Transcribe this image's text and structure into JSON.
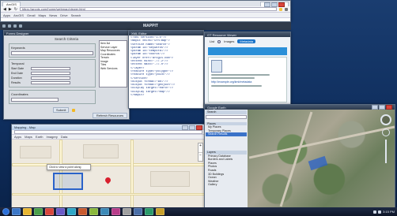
{
  "top_browser": {
    "tab": "ArcGIS",
    "url": "https://arcgis.com/home/webmap/viewer.html",
    "bookmarks": [
      "Apps",
      "ArcGIS",
      "Gmail",
      "Maps",
      "News",
      "Drive",
      "Search"
    ]
  },
  "dev_window": {
    "title": "Forms Designer",
    "app_title": "MAPPIT",
    "form_title": "Search Criteria",
    "group1": "Keywords",
    "group2": "Temporal",
    "group3": "Coordinates",
    "field_labels": [
      "Start Date",
      "End Date",
      "Duration",
      "Results"
    ],
    "submit_label": "Submit",
    "refresh_label": "Refresh Resources",
    "list_items": [
      "Item list",
      "Service Layer",
      "Map Resources",
      "Coordinates",
      "Terrain",
      "Image",
      "Tiles",
      "Web Services"
    ]
  },
  "xml_panel": {
    "title": "XML Editor",
    "lines": [
      "<?xml version=\"1.0\"?>",
      "<mapit xmlns=\"urn:map\">",
      " <service name=\"search\">",
      "  <param id=\"keywords\"/>",
      "  <param id=\"temporal\"/>",
      "  <param id=\"coords\"/>",
      "  <layer href=\"arcgis.com\">",
      "   <extent minx=\"-77.2\"/>",
      "   <extent maxx=\"-77.0\"/>",
      "  </layer>",
      "  <feature type=\"polygon\"/>",
      "  <feature type=\"point\"/>",
      " </service>",
      " <output format=\"kml\"/>",
      " <output format=\"geojson\"/>",
      " <display target=\"earth\"/>",
      " <display target=\"map\"/>",
      "</mapit>"
    ]
  },
  "right_dialog": {
    "title": "GT Resource Viewer",
    "toggle_left": "List",
    "toggle_mid": "Images",
    "toggle_right": "Metadata",
    "url_text": "http://example.org/kml/metadata"
  },
  "map_browser": {
    "title": "Mapping - Map",
    "tooltip": "Click to view a point along",
    "bookmarks": [
      "Apps",
      "Maps",
      "Earth",
      "Imagery",
      "Data"
    ]
  },
  "earth": {
    "title": "Google Earth",
    "search_header": "Search",
    "places_header": "Places",
    "layers_header": "Layers",
    "places": [
      "My Places",
      "Temporary Places",
      "Search Results"
    ],
    "layers": [
      "Primary Database",
      "Borders and Labels",
      "Places",
      "Photos",
      "Roads",
      "3D Buildings",
      "Ocean",
      "Weather",
      "Gallery"
    ]
  },
  "taskbar": {
    "clock": "3:15 PM"
  },
  "colors": {
    "accent": "#1a73c8",
    "pin": "#d8202e",
    "map_selection": "#2a62c9"
  }
}
